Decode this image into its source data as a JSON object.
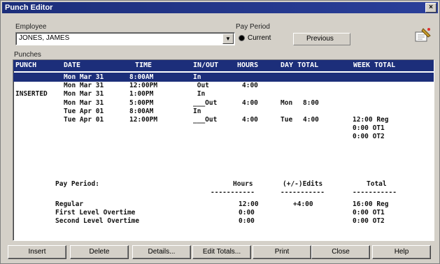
{
  "window": {
    "title": "Punch Editor"
  },
  "employee": {
    "label": "Employee",
    "value": "JONES, JAMES"
  },
  "pay_period": {
    "label": "Pay Period",
    "current": "Current",
    "previous": "Previous"
  },
  "punches_label": "Punches",
  "columns": [
    "PUNCH",
    "DATE",
    "TIME",
    "IN/OUT",
    "HOURS",
    "DAY TOTAL",
    "WEEK TOTAL"
  ],
  "rows": [
    {
      "punch": "",
      "date": "Mon Mar 31",
      "time": "8:00AM",
      "inout": "In",
      "hours": "",
      "day": "",
      "dayval": "",
      "week": ""
    },
    {
      "punch": "",
      "date": "Mon Mar 31",
      "time": "12:00PM",
      "inout": " Out",
      "hours": "4:00",
      "day": "",
      "dayval": "",
      "week": ""
    },
    {
      "punch": "INSERTED",
      "date": "Mon Mar 31",
      "time": "1:00PM",
      "inout": " In",
      "hours": "",
      "day": "",
      "dayval": "",
      "week": ""
    },
    {
      "punch": "",
      "date": "Mon Mar 31",
      "time": "5:00PM",
      "inout": "___Out",
      "hours": "4:00",
      "day": "Mon",
      "dayval": "8:00",
      "week": ""
    },
    {
      "punch": "",
      "date": "Tue Apr 01",
      "time": "8:00AM",
      "inout": "In",
      "hours": "",
      "day": "",
      "dayval": "",
      "week": ""
    },
    {
      "punch": "",
      "date": "Tue Apr 01",
      "time": "12:00PM",
      "inout": "___Out",
      "hours": "4:00",
      "day": "Tue",
      "dayval": "4:00",
      "week": "12:00 Reg"
    },
    {
      "punch": "",
      "date": "",
      "time": "",
      "inout": "",
      "hours": "",
      "day": "",
      "dayval": "",
      "week": "0:00 OT1"
    },
    {
      "punch": "",
      "date": "",
      "time": "",
      "inout": "",
      "hours": "",
      "day": "",
      "dayval": "",
      "week": "0:00 OT2"
    }
  ],
  "summary": {
    "title": "Pay Period:",
    "col_hours": "Hours",
    "col_edits": "(+/-)Edits",
    "col_total": "Total",
    "dashes_hours": "-----------",
    "dashes_edits": "-----------",
    "dashes_total": "-----------",
    "lines": [
      {
        "label": "Regular",
        "hours": "12:00",
        "edits": "+4:00",
        "total": "16:00 Reg"
      },
      {
        "label": "First Level Overtime",
        "hours": "0:00",
        "edits": "",
        "total": "0:00 OT1"
      },
      {
        "label": "Second Level Overtime",
        "hours": "0:00",
        "edits": "",
        "total": "0:00 OT2"
      }
    ]
  },
  "buttons": [
    "Insert",
    "Delete",
    "Details...",
    "Edit Totals...",
    "Print",
    "Close",
    "Help"
  ],
  "icons": {
    "close": "close-icon",
    "dropdown": "chevron-down-icon",
    "wizard": "wizard-icon"
  }
}
